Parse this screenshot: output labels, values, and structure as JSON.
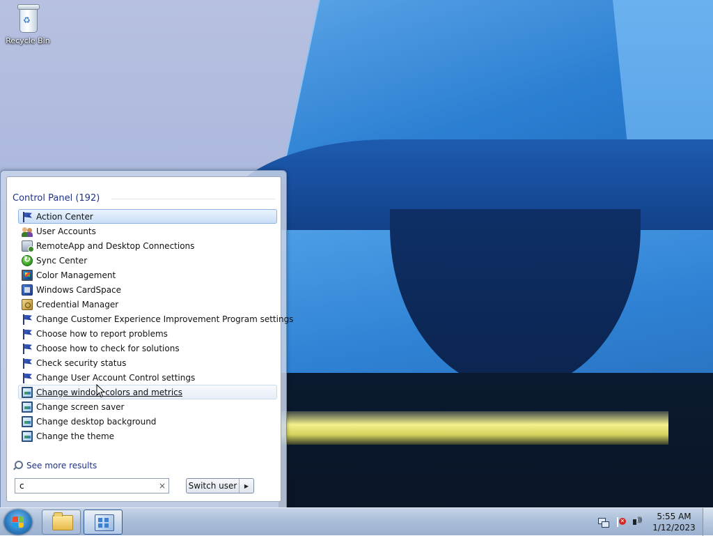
{
  "desktop": {
    "icons": [
      {
        "label": "Recycle Bin",
        "icon": "recycle-bin-icon"
      }
    ]
  },
  "start_menu": {
    "group_header": "Control Panel (192)",
    "results": [
      {
        "label": "Action Center",
        "icon": "flag-icon",
        "state": "selected"
      },
      {
        "label": "User Accounts",
        "icon": "users-icon",
        "state": ""
      },
      {
        "label": "RemoteApp and Desktop Connections",
        "icon": "remote-desktop-icon",
        "state": ""
      },
      {
        "label": "Sync Center",
        "icon": "sync-icon",
        "state": ""
      },
      {
        "label": "Color Management",
        "icon": "monitor-icon",
        "state": ""
      },
      {
        "label": "Windows CardSpace",
        "icon": "cardspace-icon",
        "state": ""
      },
      {
        "label": "Credential Manager",
        "icon": "vault-icon",
        "state": ""
      },
      {
        "label": "Change Customer Experience Improvement Program settings",
        "icon": "flag-icon",
        "state": ""
      },
      {
        "label": "Choose how to report problems",
        "icon": "flag-icon",
        "state": ""
      },
      {
        "label": "Choose how to check for solutions",
        "icon": "flag-icon",
        "state": ""
      },
      {
        "label": "Check security status",
        "icon": "flag-icon",
        "state": ""
      },
      {
        "label": "Change User Account Control settings",
        "icon": "flag-icon",
        "state": ""
      },
      {
        "label": "Change window colors and metrics",
        "icon": "screen-icon",
        "state": "hovered"
      },
      {
        "label": "Change screen saver",
        "icon": "screen-icon",
        "state": ""
      },
      {
        "label": "Change desktop background",
        "icon": "screen-icon",
        "state": ""
      },
      {
        "label": "Change the theme",
        "icon": "screen-icon",
        "state": ""
      }
    ],
    "see_more": "See more results",
    "search": {
      "value": "c",
      "clear_symbol": "×"
    },
    "switch_user": {
      "label": "Switch user",
      "arrow": "▶"
    }
  },
  "taskbar": {
    "pinned": [
      {
        "name": "windows-explorer",
        "icon": "folder-icon"
      },
      {
        "name": "control-panel",
        "icon": "control-panel-icon"
      }
    ],
    "clock": {
      "time": "5:55 AM",
      "date": "1/12/2023"
    }
  },
  "colors": {
    "accent": "#1e3287",
    "selection": "#c9def7",
    "taskbar": "#a9bdd8"
  }
}
